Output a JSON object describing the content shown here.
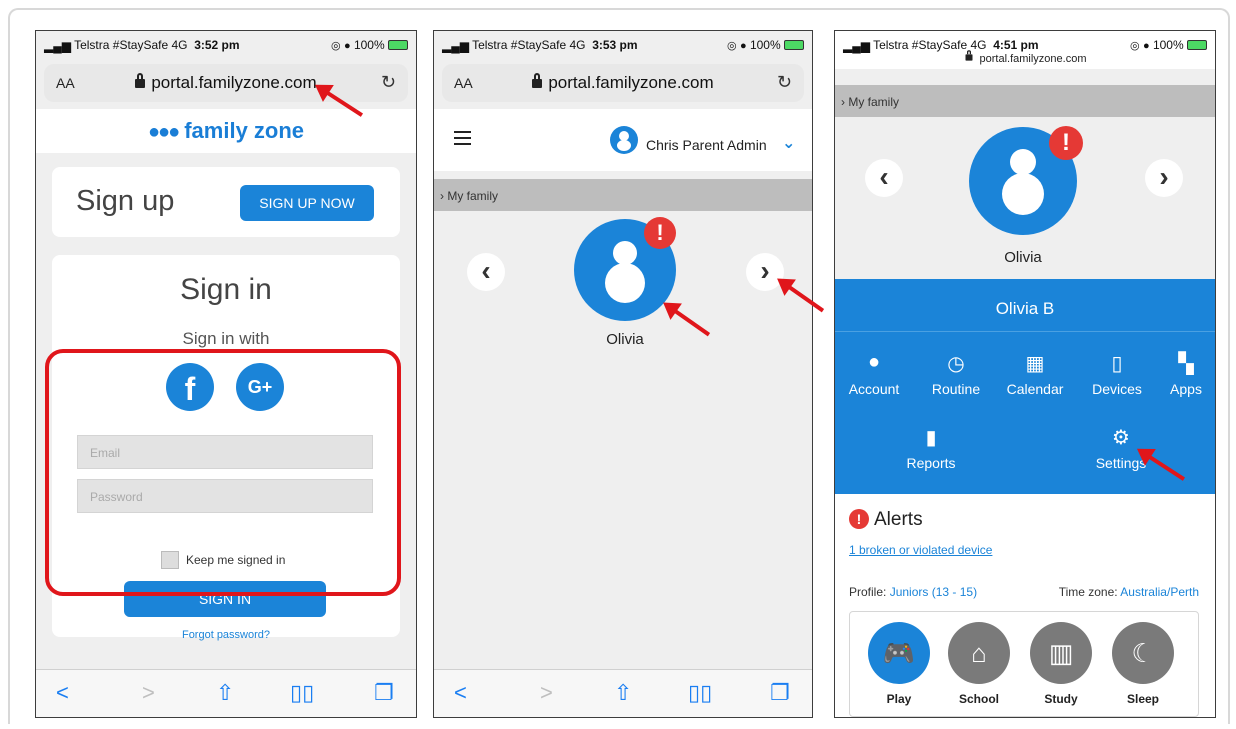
{
  "phone1": {
    "status": {
      "carrier": "Telstra #StaySafe",
      "network": "4G",
      "time": "3:52 pm",
      "battery": "100%"
    },
    "url": {
      "aa": "AA",
      "domain": "portal.familyzone.com"
    },
    "logo_text": "family zone",
    "signup": {
      "title": "Sign up",
      "button": "SIGN UP NOW"
    },
    "signin": {
      "title": "Sign in",
      "with": "Sign in with",
      "facebook": "f",
      "google": "G+",
      "email_placeholder": "Email",
      "password_placeholder": "Password",
      "keep_signed_in": "Keep me signed in",
      "button": "SIGN IN",
      "forgot": "Forgot password?"
    }
  },
  "phone2": {
    "status": {
      "carrier": "Telstra #StaySafe",
      "network": "4G",
      "time": "3:53 pm",
      "battery": "100%"
    },
    "url": {
      "aa": "AA",
      "domain": "portal.familyzone.com"
    },
    "admin_name": "Chris Parent Admin",
    "breadcrumb": "My family",
    "child_name": "Olivia"
  },
  "phone3": {
    "status": {
      "carrier": "Telstra #StaySafe",
      "network": "4G",
      "time": "4:51 pm",
      "battery": "100%"
    },
    "url": {
      "domain": "portal.familyzone.com"
    },
    "breadcrumb": "My family",
    "child_name": "Olivia",
    "full_name": "Olivia B",
    "menu": {
      "account": "Account",
      "routine": "Routine",
      "calendar": "Calendar",
      "devices": "Devices",
      "apps": "Apps",
      "reports": "Reports",
      "settings": "Settings"
    },
    "alerts": {
      "title": "Alerts",
      "link": "1 broken or violated device"
    },
    "profile": {
      "label": "Profile:",
      "value": "Juniors (13 - 15)"
    },
    "timezone": {
      "label": "Time zone:",
      "value": "Australia/Perth"
    },
    "modes": [
      "Play",
      "School",
      "Study",
      "Sleep"
    ]
  },
  "colors": {
    "brand_blue": "#1b84d8",
    "alert_red": "#e53935",
    "annotation_red": "#e0161b"
  }
}
